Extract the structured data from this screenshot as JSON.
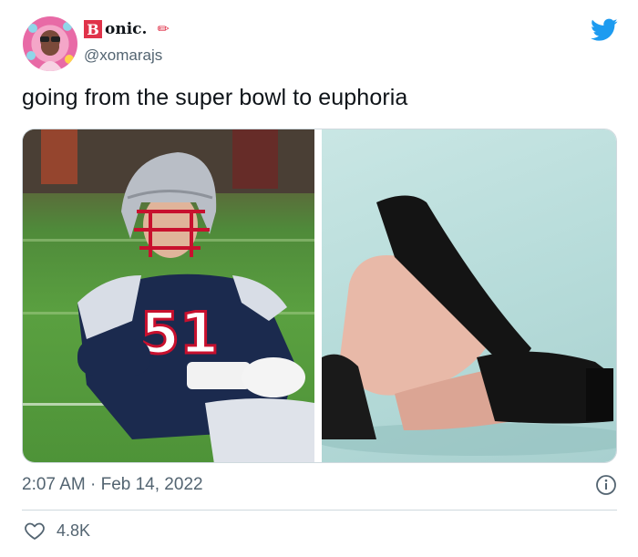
{
  "author": {
    "badge_letter": "B",
    "name_rest": "onic.",
    "name_emoji": "✏",
    "handle": "@xomarajs"
  },
  "tweet": {
    "text": "going from the super bowl to euphoria",
    "timestamp": "2:07 AM · Feb 14, 2022",
    "likes": "4.8K"
  },
  "media": {
    "left_jersey_number": "51",
    "left_alt": "football player in helmet sitting on field",
    "right_alt": "legs in black boots lying on floor"
  },
  "colors": {
    "twitter_blue": "#1d9bf0",
    "badge_red": "#e0334a",
    "secondary_text": "#536471",
    "jersey_navy": "#1b2a4e",
    "jersey_red": "#c8102e"
  },
  "icons": {
    "logo": "twitter-bird-icon",
    "info": "info-icon",
    "like": "heart-icon"
  }
}
